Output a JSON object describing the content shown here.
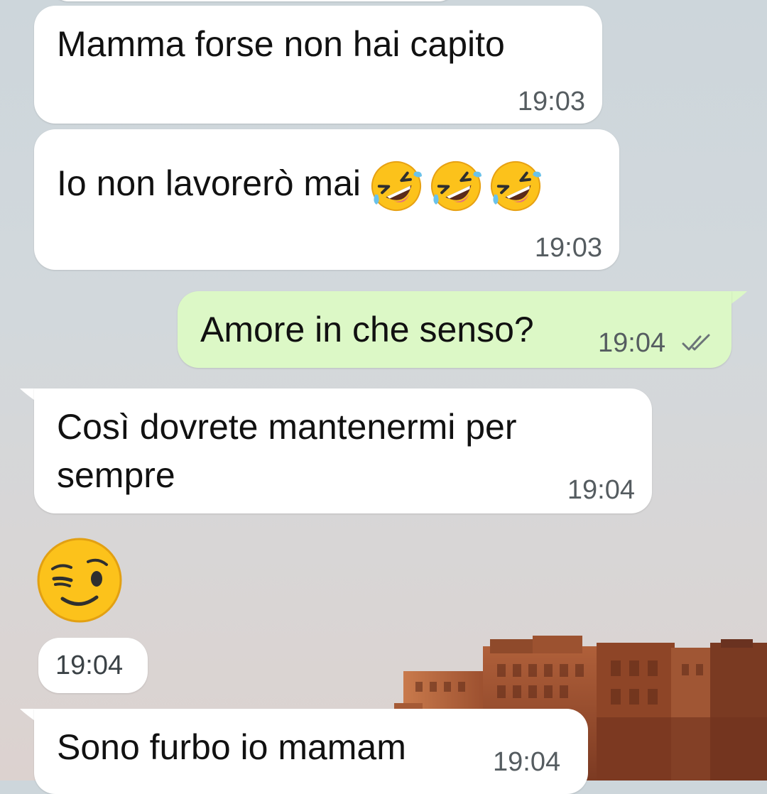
{
  "chat": {
    "messages": [
      {
        "direction": "incoming",
        "text": "Mamma forse non hai capito",
        "time": "19:03"
      },
      {
        "direction": "incoming",
        "text": "Io non lavorerò mai",
        "emoji": [
          "rolling-on-floor-laughing",
          "rolling-on-floor-laughing",
          "rolling-on-floor-laughing"
        ],
        "time": "19:03"
      },
      {
        "direction": "outgoing",
        "text": "Amore in che senso?",
        "time": "19:04",
        "status": "read-double-check"
      },
      {
        "direction": "incoming",
        "text_line1": "Così dovrete mantenermi per",
        "text_line2": "sempre",
        "time": "19:04"
      },
      {
        "direction": "incoming",
        "emoji": "winking-face",
        "time": "19:04"
      },
      {
        "direction": "incoming",
        "text": "Sono furbo io mamam",
        "time": "19:04"
      }
    ]
  },
  "colors": {
    "incoming_bubble": "#ffffff",
    "outgoing_bubble": "#dcf8c6",
    "timestamp": "#555c60",
    "read_ticks": "#6b7378"
  },
  "background": {
    "image": "sunset sky with desert fort"
  }
}
